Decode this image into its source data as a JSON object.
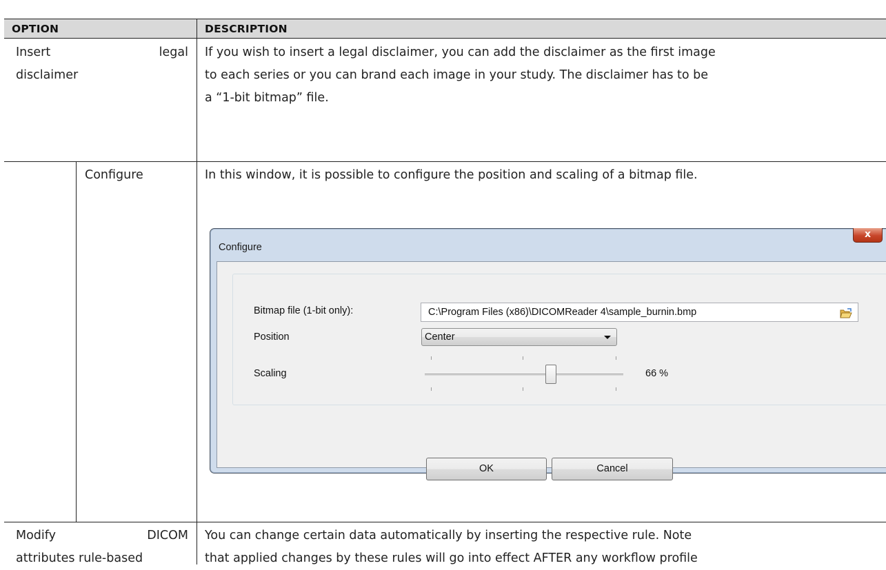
{
  "table": {
    "headers": {
      "option": "OPTION",
      "description": "DESCRIPTION"
    },
    "rows": [
      {
        "option_words": [
          "Insert",
          "legal"
        ],
        "option_line2": "disclaimer",
        "description_lines": [
          "If you wish to insert a legal disclaimer, you can add the disclaimer as the first image",
          "to each series or you can brand each image in your study. The disclaimer has to be",
          "a “1-bit bitmap” file."
        ]
      },
      {
        "option": "Configure",
        "description_lines": [
          "In this window, it is possible to configure the position and scaling of a bitmap file."
        ]
      },
      {
        "option_words": [
          "Modify",
          "DICOM"
        ],
        "option_line2": "attributes rule-based",
        "description_lines": [
          "You can change certain data automatically by inserting the respective rule. Note",
          "that applied changes by these rules will go into effect AFTER any workflow profile"
        ]
      }
    ]
  },
  "dialog": {
    "title": "Configure",
    "close_label": "x",
    "bitmap_label": "Bitmap file (1-bit only):",
    "bitmap_value": "C:\\Program Files (x86)\\DICOMReader 4\\sample_burnin.bmp",
    "position_label": "Position",
    "position_value": "Center",
    "scaling_label": "Scaling",
    "scaling_value": "66 %",
    "scaling_level": 0.66,
    "ok_label": "OK",
    "cancel_label": "Cancel",
    "icons": {
      "browse": "folder-open-icon",
      "dropdown": "chevron-down-icon"
    }
  }
}
